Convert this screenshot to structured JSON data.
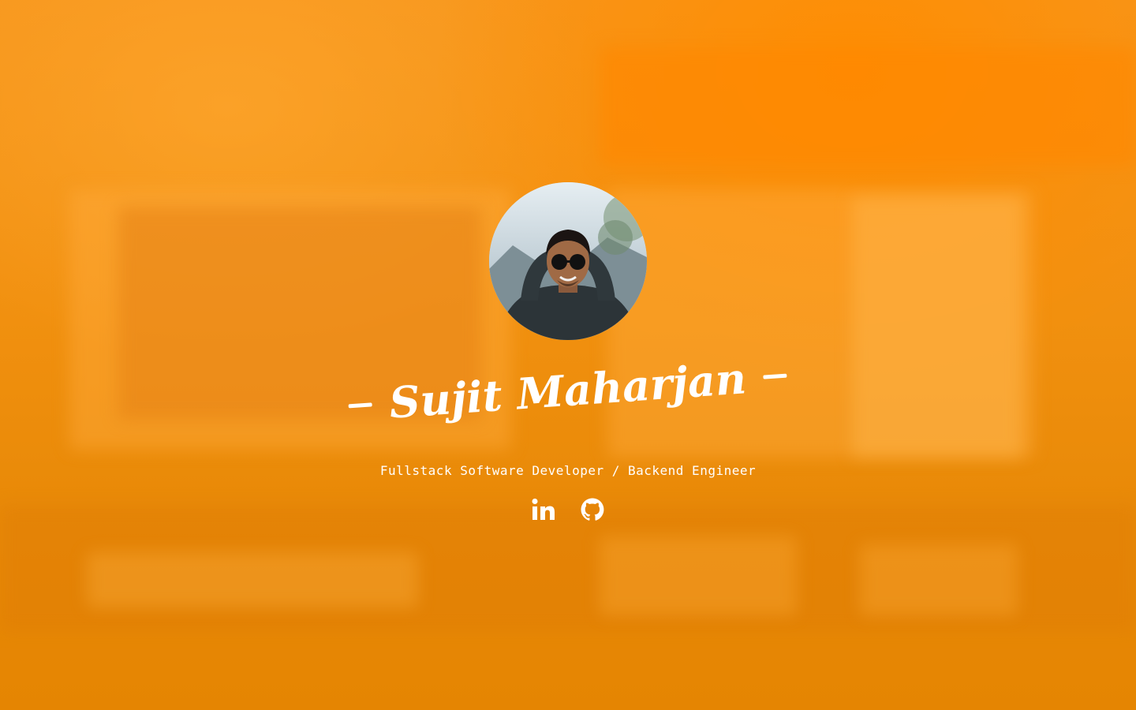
{
  "profile": {
    "name": "Sujit Maharjan",
    "subtitle": "Fullstack Software Developer / Backend Engineer",
    "avatar_icon": "avatar-photo"
  },
  "social": [
    {
      "icon": "linkedin-icon",
      "label": "LinkedIn"
    },
    {
      "icon": "github-icon",
      "label": "GitHub"
    }
  ],
  "colors": {
    "accent": "#f28c10",
    "text": "#ffffff"
  }
}
